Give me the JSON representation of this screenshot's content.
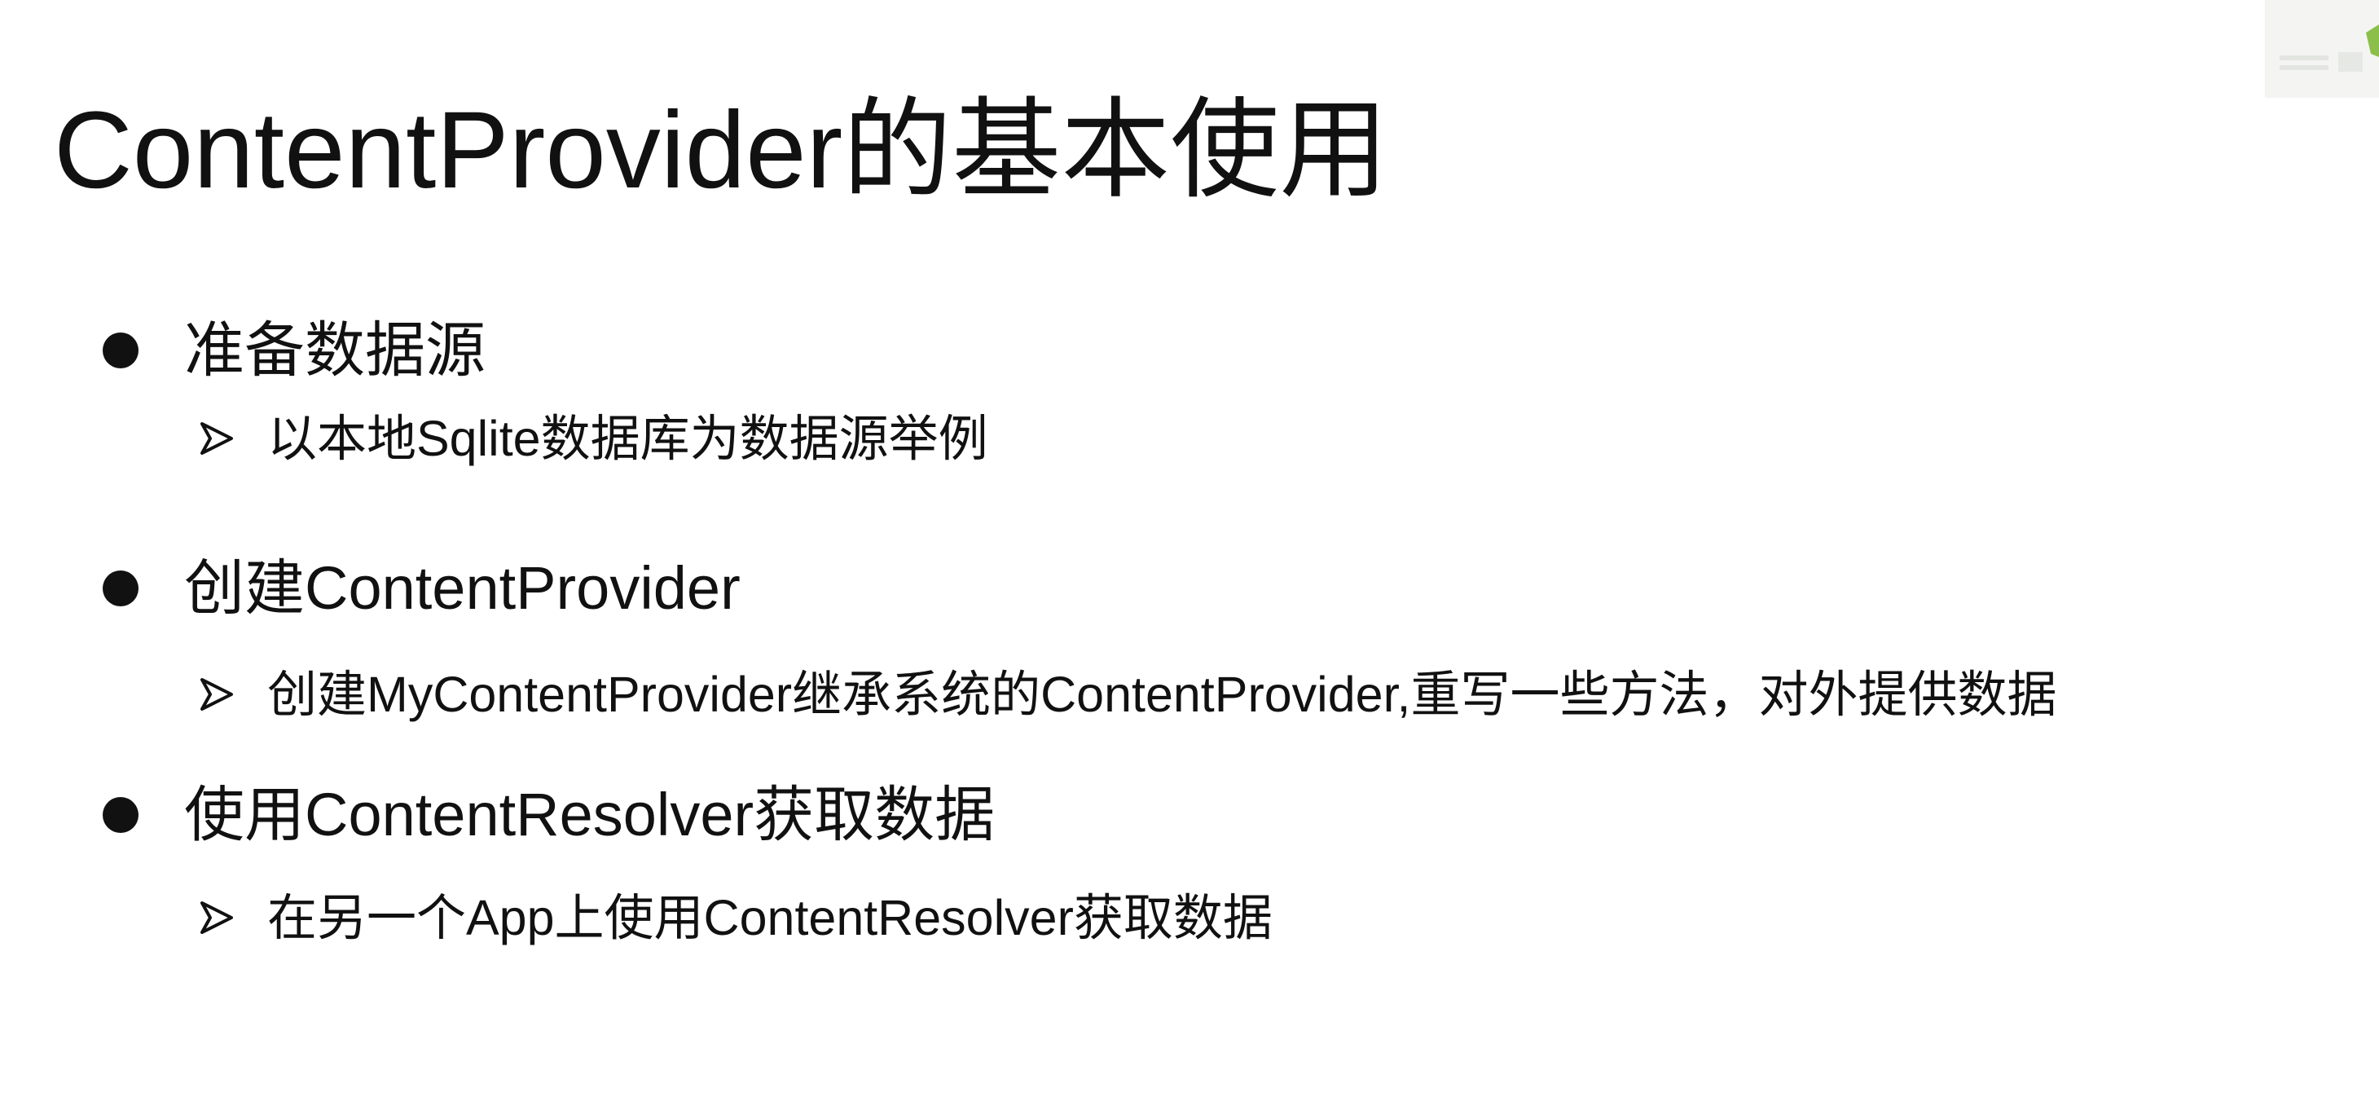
{
  "title": "ContentProvider的基本使用",
  "bullets": [
    {
      "text": "准备数据源",
      "sub": "以本地Sqlite数据库为数据源举例"
    },
    {
      "text": "创建ContentProvider",
      "sub": "创建MyContentProvider继承系统的ContentProvider,重写一些方法，对外提供数据"
    },
    {
      "text": "使用ContentResolver获取数据",
      "sub": "在另一个App上使用ContentResolver获取数据"
    }
  ],
  "icons": {
    "bullet": "filled-circle-bullet-icon",
    "sub_bullet": "arrowhead-bullet-icon",
    "corner": "watermark-logo"
  },
  "colors": {
    "text": "#111111",
    "background": "#ffffff",
    "logo_accent": "#8bbf4a"
  }
}
